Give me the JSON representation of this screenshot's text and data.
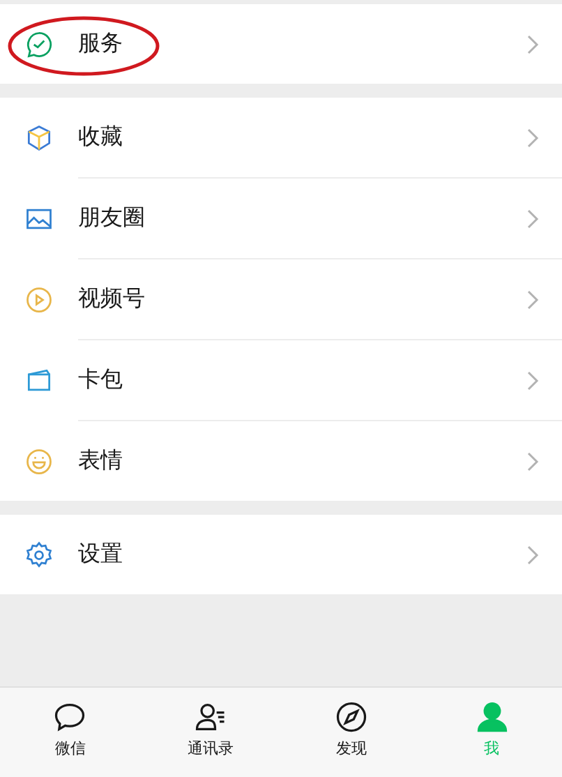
{
  "sections": [
    {
      "items": [
        {
          "kind": "service",
          "label": "服务",
          "circled": true
        }
      ]
    },
    {
      "items": [
        {
          "kind": "favorites",
          "label": "收藏",
          "circled": false
        },
        {
          "kind": "moments",
          "label": "朋友圈",
          "circled": false
        },
        {
          "kind": "channels",
          "label": "视频号",
          "circled": false
        },
        {
          "kind": "cards",
          "label": "卡包",
          "circled": false
        },
        {
          "kind": "stickers",
          "label": "表情",
          "circled": false
        }
      ]
    },
    {
      "items": [
        {
          "kind": "settings",
          "label": "设置",
          "circled": false
        }
      ]
    }
  ],
  "tabs": [
    {
      "kind": "chats",
      "label": "微信",
      "selected": false
    },
    {
      "kind": "contacts",
      "label": "通讯录",
      "selected": false
    },
    {
      "kind": "discover",
      "label": "发现",
      "selected": false
    },
    {
      "kind": "me",
      "label": "我",
      "selected": true
    }
  ]
}
